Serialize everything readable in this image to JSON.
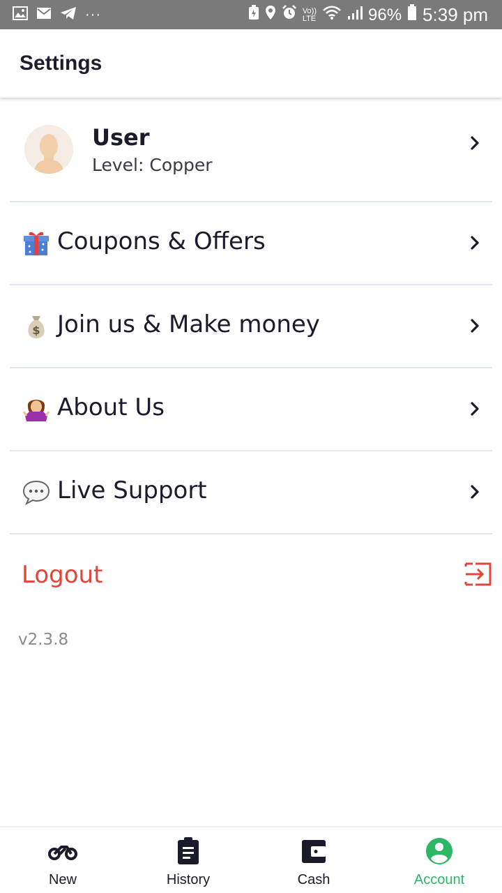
{
  "status_bar": {
    "battery": "96%",
    "time": "5:39 pm",
    "lte_label_top": "Vo))",
    "lte_label_bottom": "LTE",
    "overflow": "···"
  },
  "header": {
    "title": "Settings"
  },
  "profile": {
    "name": "User",
    "level": "Level: Copper"
  },
  "menu": {
    "items": [
      {
        "label": "Coupons & Offers",
        "icon": "gift-icon"
      },
      {
        "label": "Join us & Make money",
        "icon": "money-bag-icon"
      },
      {
        "label": "About Us",
        "icon": "person-shrugging-icon"
      },
      {
        "label": "Live Support",
        "icon": "speech-bubble-icon"
      }
    ]
  },
  "logout": {
    "label": "Logout",
    "color": "#e2453c"
  },
  "version": "v2.3.8",
  "bottom_nav": {
    "items": [
      {
        "label": "New",
        "icon": "motorcycle-icon"
      },
      {
        "label": "History",
        "icon": "clipboard-icon"
      },
      {
        "label": "Cash",
        "icon": "wallet-icon"
      },
      {
        "label": "Account",
        "icon": "account-icon",
        "active": true
      }
    ],
    "active_color": "#2db664"
  }
}
